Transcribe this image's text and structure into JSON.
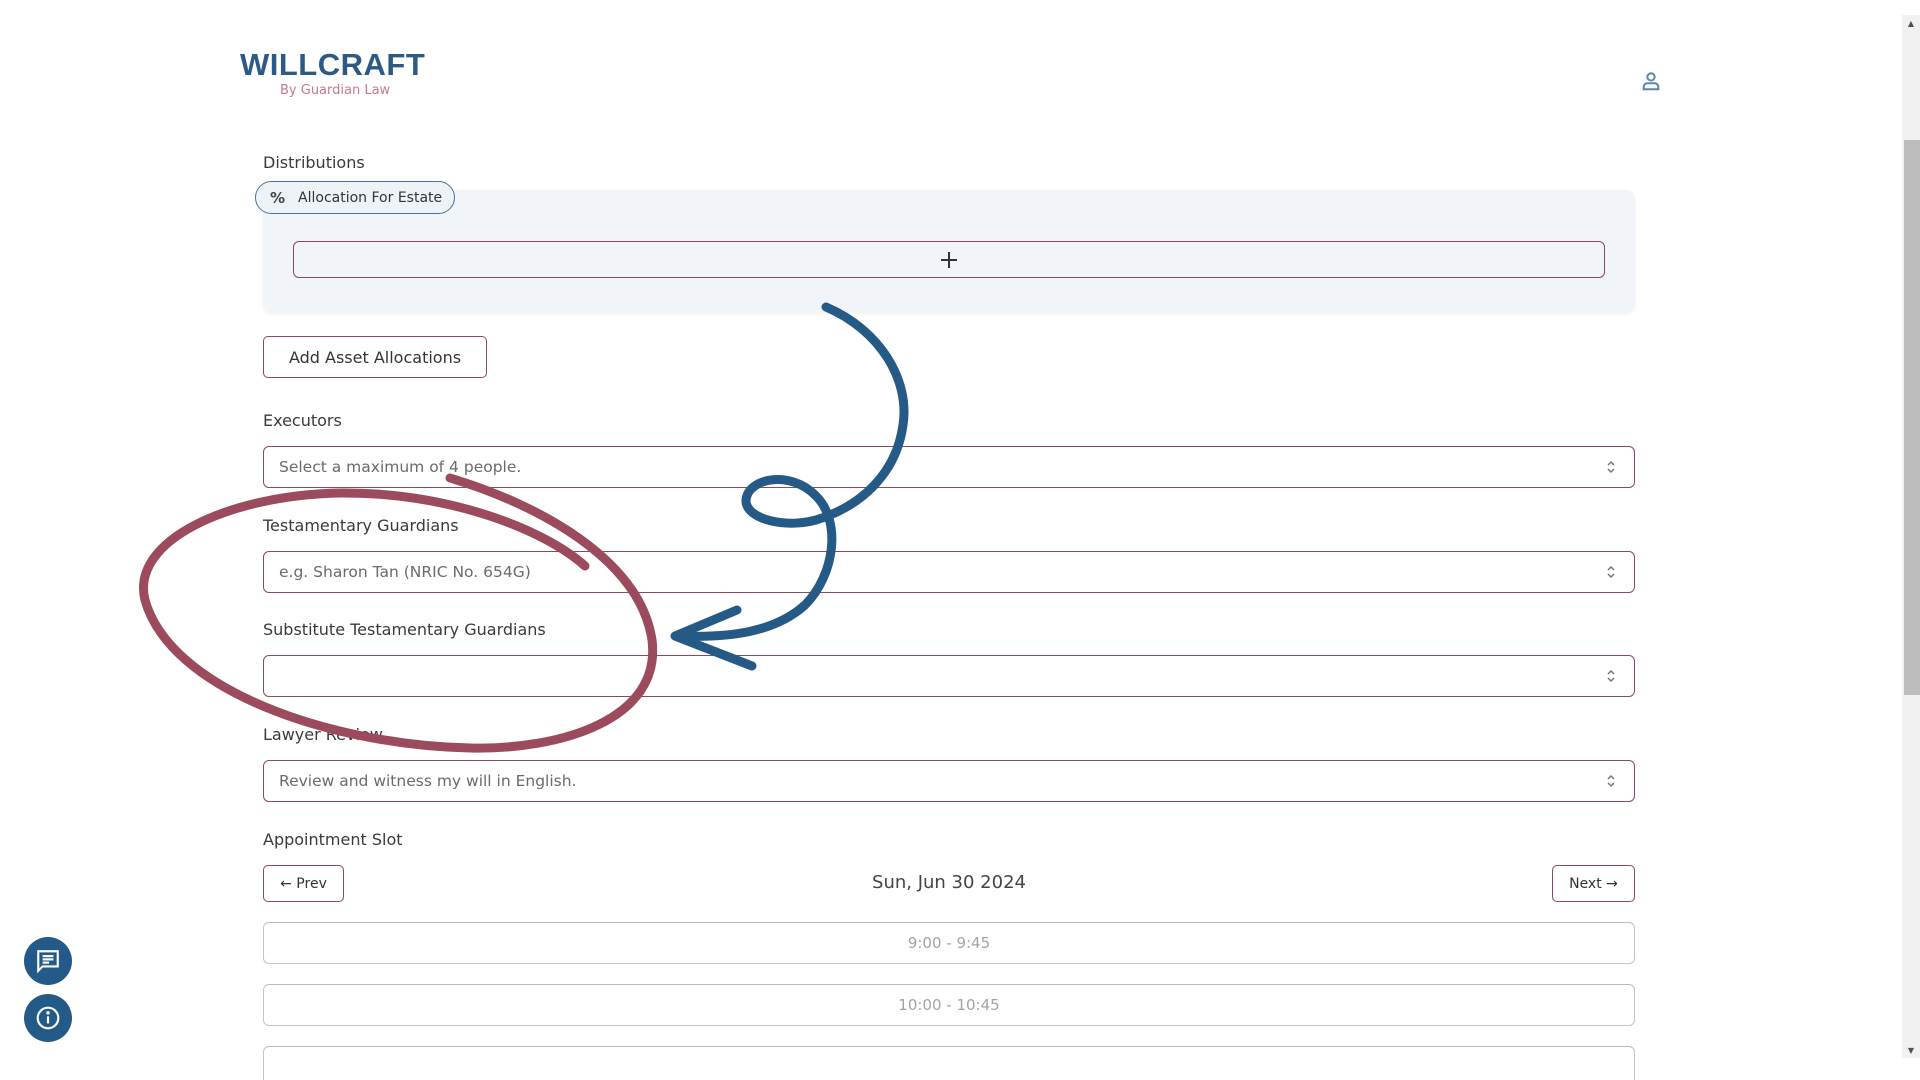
{
  "brand": {
    "title": "WILLCRAFT",
    "subtitle": "By Guardian Law",
    "primary_color": "#2d5a85",
    "accent_color": "#c57a8a"
  },
  "header": {
    "user_icon": "user-icon"
  },
  "distributions": {
    "label": "Distributions",
    "chip_icon": "percent-icon",
    "chip_icon_glyph": "%",
    "chip_label": "Allocation For Estate",
    "add_icon": "plus-icon"
  },
  "add_asset_button": "Add Asset Allocations",
  "executors": {
    "label": "Executors",
    "placeholder": "Select a maximum of 4 people.",
    "icon": "chevron-up-down-icon"
  },
  "testamentary_guardians": {
    "label": "Testamentary Guardians",
    "placeholder": "e.g. Sharon Tan (NRIC No. 654G)",
    "icon": "chevron-up-down-icon"
  },
  "substitute_guardians": {
    "label": "Substitute Testamentary Guardians",
    "value": "",
    "icon": "chevron-up-down-icon"
  },
  "lawyer_review": {
    "label": "Lawyer Review",
    "value": "Review and witness my will in English.",
    "icon": "chevron-up-down-icon"
  },
  "appointment": {
    "label": "Appointment Slot",
    "prev_label": "← Prev",
    "next_label": "Next →",
    "date": "Sun, Jun 30 2024",
    "slots": [
      "9:00 - 9:45",
      "10:00 - 10:45",
      ""
    ]
  },
  "floating_buttons": {
    "chat_icon": "chat-icon",
    "info_icon": "info-icon"
  },
  "annotations": {
    "circle_color": "#9c4a5e",
    "arrow_color": "#245a85"
  }
}
